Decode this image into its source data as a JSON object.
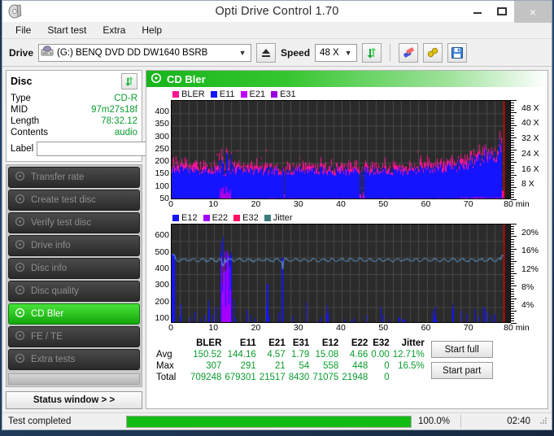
{
  "window": {
    "title": "Opti Drive Control 1.70",
    "minimize": "–",
    "maximize": "❑",
    "close": "×",
    "app_icon": "disc-icon"
  },
  "menu": {
    "items": [
      "File",
      "Start test",
      "Extra",
      "Help"
    ]
  },
  "toolbar": {
    "drive_label": "Drive",
    "drive_value": "(G:)   BENQ DVD DD DW1640 BSRB",
    "eject_icon": "eject-icon",
    "speed_label": "Speed",
    "speed_value": "48 X",
    "refresh_icon": "refresh-arrows-icon",
    "erase_icon": "eraser-icon",
    "settings_icon": "tools-icon",
    "save_icon": "floppy-save-icon"
  },
  "disc_panel": {
    "title": "Disc",
    "refresh_icon": "refresh-arrows-icon",
    "rows": [
      {
        "key": "Type",
        "value": "CD-R"
      },
      {
        "key": "MID",
        "value": "97m27s18f"
      },
      {
        "key": "Length",
        "value": "78:32.12"
      },
      {
        "key": "Contents",
        "value": "audio"
      }
    ],
    "label_key": "Label",
    "label_value": "",
    "label_placeholder": "",
    "disc_icon": "cd-disc-icon"
  },
  "nav": {
    "items": [
      {
        "label": "Transfer rate",
        "icon": "disc-icon",
        "active": false
      },
      {
        "label": "Create test disc",
        "icon": "disc-burn-icon",
        "active": false
      },
      {
        "label": "Verify test disc",
        "icon": "disc-check-icon",
        "active": false
      },
      {
        "label": "Drive info",
        "icon": "drive-icon",
        "active": false
      },
      {
        "label": "Disc info",
        "icon": "disc-info-icon",
        "active": false
      },
      {
        "label": "Disc quality",
        "icon": "disc-quality-icon",
        "active": false
      },
      {
        "label": "CD Bler",
        "icon": "disc-bler-icon",
        "active": true
      },
      {
        "label": "FE / TE",
        "icon": "disc-fete-icon",
        "active": false
      },
      {
        "label": "Extra tests",
        "icon": "disc-extra-icon",
        "active": false
      }
    ],
    "status_button": "Status window > >"
  },
  "panel": {
    "title": "CD Bler",
    "icon": "disc-bler-icon"
  },
  "actions": {
    "start_full": "Start full",
    "start_part": "Start part"
  },
  "statusbar": {
    "text": "Test completed",
    "percent_label": "100.0%",
    "percent_value": 100,
    "time": "02:40"
  },
  "stats": {
    "columns": [
      "BLER",
      "E11",
      "E21",
      "E31",
      "E12",
      "E22",
      "E32",
      "Jitter"
    ],
    "rows": [
      {
        "label": "Avg",
        "values": [
          "150.52",
          "144.16",
          "4.57",
          "1.79",
          "15.08",
          "4.66",
          "0.00",
          "12.71%"
        ]
      },
      {
        "label": "Max",
        "values": [
          "307",
          "291",
          "21",
          "54",
          "558",
          "448",
          "0",
          "16.5%"
        ]
      },
      {
        "label": "Total",
        "values": [
          "709248",
          "679301",
          "21517",
          "8430",
          "71075",
          "21948",
          "0",
          ""
        ]
      }
    ]
  },
  "chart_data": [
    {
      "type": "area",
      "id": "cd-bler-chart",
      "title": "CD Bler",
      "xlabel": "80 min",
      "ylabel": "",
      "xlim": [
        0,
        80
      ],
      "ylim": [
        0,
        400
      ],
      "x_ticks": [
        "0",
        "10",
        "20",
        "30",
        "40",
        "50",
        "60",
        "70",
        "80 min"
      ],
      "y_ticks": [
        "50",
        "100",
        "150",
        "200",
        "250",
        "300",
        "350",
        "400"
      ],
      "right_axis_ticks": [
        "8 X",
        "16 X",
        "24 X",
        "32 X",
        "40 X",
        "48 X"
      ],
      "right_axis_lim": [
        0,
        52
      ],
      "grid": true,
      "legend_position": "top-left",
      "legend": [
        {
          "name": "BLER",
          "color": "#ff1493"
        },
        {
          "name": "E11",
          "color": "#1414ff"
        },
        {
          "name": "E21",
          "color": "#c000ff"
        },
        {
          "name": "E31",
          "color": "#9900dd"
        }
      ],
      "series": [
        {
          "name": "BLER",
          "color": "#ff1493",
          "avg": 150.52,
          "max": 307,
          "total": 709248
        },
        {
          "name": "E11",
          "color": "#1414ff",
          "avg": 144.16,
          "max": 291,
          "total": 679301
        },
        {
          "name": "E21",
          "color": "#c000ff",
          "avg": 4.57,
          "max": 21,
          "total": 21517
        },
        {
          "name": "E31",
          "color": "#9900dd",
          "avg": 1.79,
          "max": 54,
          "total": 8430
        }
      ],
      "notes": "BLER/E11 dense band ~110-200 rising to ~300 near 78 min; E21/E31 low baseline with purple burst at 11-14 min reaching ~60; read speed CAV ramp ends at red cursor near 78 min"
    },
    {
      "type": "line",
      "id": "cd-bler-e12-chart",
      "title": "",
      "xlabel": "80 min",
      "ylabel": "",
      "xlim": [
        0,
        80
      ],
      "ylim": [
        0,
        600
      ],
      "x_ticks": [
        "0",
        "10",
        "20",
        "30",
        "40",
        "50",
        "60",
        "70",
        "80 min"
      ],
      "y_ticks": [
        "100",
        "200",
        "300",
        "400",
        "500",
        "600"
      ],
      "right_axis_ticks": [
        "4%",
        "8%",
        "12%",
        "16%",
        "20%"
      ],
      "right_axis_lim": [
        0,
        22
      ],
      "grid": true,
      "legend_position": "top-left",
      "legend": [
        {
          "name": "E12",
          "color": "#1414ff"
        },
        {
          "name": "E22",
          "color": "#a400ff"
        },
        {
          "name": "E32",
          "color": "#ff1060"
        },
        {
          "name": "Jitter",
          "color": "#3d7c7c"
        }
      ],
      "series": [
        {
          "name": "E12",
          "color": "#1414ff",
          "avg": 15.08,
          "max": 558,
          "total": 71075
        },
        {
          "name": "E22",
          "color": "#a400ff",
          "avg": 4.66,
          "max": 448,
          "total": 21948
        },
        {
          "name": "E32",
          "color": "#ff1060",
          "avg": 0.0,
          "max": 0,
          "total": 0
        },
        {
          "name": "Jitter",
          "color": "#6aa9e0",
          "avg": 12.71,
          "max": 16.5,
          "unit": "%"
        }
      ],
      "notes": "Jitter trace (light blue) flat around 12% (≈385 on left scale); E12 spikes to 558 near 13 min with E22 purple cluster at 11-14 min; red cursor line near 78 min"
    }
  ]
}
